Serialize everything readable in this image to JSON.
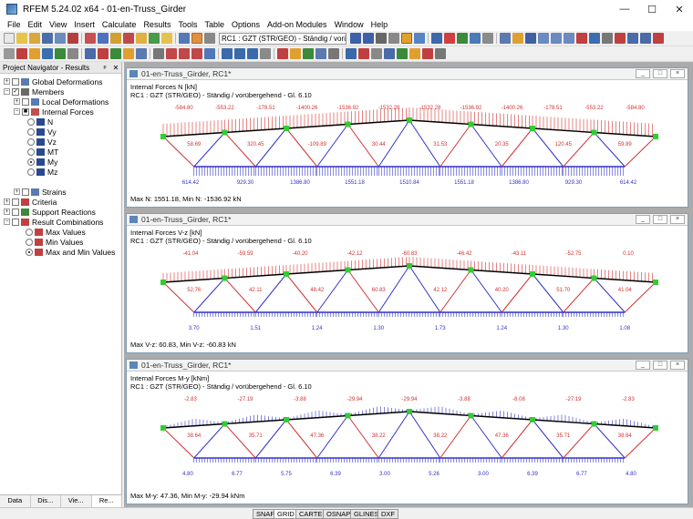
{
  "window": {
    "title": "RFEM 5.24.02 x64 - 01-en-Truss_Girder",
    "minimize": "—",
    "maximize": "☐",
    "close": "✕"
  },
  "menu": [
    "File",
    "Edit",
    "View",
    "Insert",
    "Calculate",
    "Results",
    "Tools",
    "Table",
    "Options",
    "Add-on Modules",
    "Window",
    "Help"
  ],
  "toolbar": {
    "load_case": "RC1 : GZT (STR/GEO) - Ständig / vorüb"
  },
  "navigator": {
    "title": "Project Navigator - Results",
    "pin": "ᵖ",
    "close": "✕",
    "items": [
      {
        "label": "Global Deformations"
      },
      {
        "label": "Members"
      },
      {
        "label": "Local Deformations"
      },
      {
        "label": "Internal Forces"
      },
      {
        "label": "N"
      },
      {
        "label": "Vy"
      },
      {
        "label": "Vz"
      },
      {
        "label": "MT"
      },
      {
        "label": "My"
      },
      {
        "label": "Mz"
      },
      {
        "label": "Strains"
      },
      {
        "label": "Criteria"
      },
      {
        "label": "Support Reactions"
      },
      {
        "label": "Result Combinations"
      },
      {
        "label": "Max Values"
      },
      {
        "label": "Min Values"
      },
      {
        "label": "Max and Min Values"
      }
    ],
    "tabs": [
      "Data",
      "Dis...",
      "Vie...",
      "Re..."
    ]
  },
  "windows": [
    {
      "title": "01-en-Truss_Girder, RC1*",
      "line1": "Internal Forces N [kN]",
      "line2": "RC1 : GZT (STR/GEO) - Ständig / vorübergehend - Gl. 6.10",
      "minmax": "Max N: 1551.18, Min N: -1536.92 kN",
      "top_labels": [
        "-584.80",
        "-553.22",
        "-178.51",
        "-1400.26",
        "-1536.92",
        "-1532.28",
        "-1532.28",
        "-1536.92",
        "-1400.26",
        "-178.51",
        "-553.22",
        "-584.80"
      ],
      "mid_labels": [
        "58.69",
        "320.45",
        "-109.89",
        "30.44",
        "31.53",
        "20.35",
        "120.45",
        "59.89"
      ],
      "bot_labels": [
        "614.42",
        "929.30",
        "1386.80",
        "1551.18",
        "1510.84",
        "1551.18",
        "1386.80",
        "929.30",
        "614.42"
      ]
    },
    {
      "title": "01-en-Truss_Girder, RC1*",
      "line1": "Internal Forces V-z [kN]",
      "line2": "RC1 : GZT (STR/GEO) - Ständig / vorübergehend - Gl. 6.10",
      "minmax": "Max V-z: 60.83, Min V-z: -60.83 kN",
      "top_labels": [
        "-41.04",
        "-59.59",
        "-40.20",
        "-42.12",
        "-60.83",
        "-46.42",
        "-43.11",
        "-52.75",
        "0.10"
      ],
      "mid_labels": [
        "52.76",
        "42.11",
        "48.42",
        "60.83",
        "42.12",
        "40.20",
        "51.70",
        "41.04"
      ],
      "bot_labels": [
        "3.70",
        "1.51",
        "1.24",
        "1.30",
        "1.73",
        "1.24",
        "1.30",
        "1.08"
      ]
    },
    {
      "title": "01-en-Truss_Girder, RC1*",
      "line1": "Internal Forces M-y [kNm]",
      "line2": "RC1 : GZT (STR/GEO) - Ständig / vorübergehend - Gl. 6.10",
      "minmax": "Max M-y: 47.36, Min M-y: -29.94 kNm",
      "top_labels": [
        "-2.83",
        "-27.19",
        "-3.88",
        "-29.94",
        "-29.94",
        "-3.88",
        "-8.08",
        "-27.19",
        "-2.83"
      ],
      "mid_labels": [
        "38.64",
        "35.71",
        "47.36",
        "38.22",
        "38.22",
        "47.36",
        "35.71",
        "38.64"
      ],
      "bot_labels": [
        "4.80",
        "6.77",
        "5.75",
        "6.39",
        "3.00",
        "5.26",
        "3.00",
        "6.39",
        "6.77",
        "4.80"
      ]
    }
  ],
  "status": [
    "SNAP",
    "GRID",
    "CARTES",
    "OSNAP",
    "GLINES",
    "DXF"
  ],
  "colors": {
    "tension": "#3232c8",
    "compression": "#d23232",
    "node": "#33cc33",
    "chord": "#000000"
  }
}
